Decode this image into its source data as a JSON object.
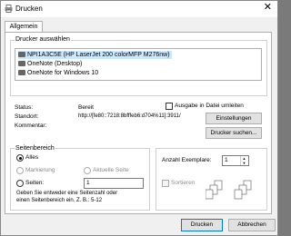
{
  "window": {
    "title": "Drucken"
  },
  "tabs": [
    {
      "label": "Allgemein"
    }
  ],
  "printers": {
    "group_label": "Drucker auswählen",
    "items": [
      {
        "label": "NPI1A3C5E (HP LaserJet 200 colorMFP M276nw)",
        "selected": true
      },
      {
        "label": "OneNote (Desktop)",
        "selected": false
      },
      {
        "label": "OneNote for Windows 10",
        "selected": false
      }
    ]
  },
  "details": {
    "status_label": "Status:",
    "status_value": "Bereit",
    "location_label": "Standort:",
    "location_value": "http://[fe80::7218:8bfffeb6:d704%11]:3911/",
    "comment_label": "Kommentar:",
    "print_to_file_label": "Ausgabe in Datei umleiten",
    "preferences_button": "Einstellungen",
    "find_printer_button": "Drucker suchen..."
  },
  "page_range": {
    "group_label": "Seitenbereich",
    "all_label": "Alles",
    "selection_label": "Markierung",
    "current_page_label": "Aktuelle Seite",
    "pages_label": "Seiten:",
    "pages_value": "1",
    "hint_line1": "Geben Sie entweder eine Seitenzahl oder",
    "hint_line2": "einen Seitenbereich ein. Z. B.: 5-12"
  },
  "copies": {
    "label": "Anzahl Exemplare:",
    "value": "1",
    "collate_label": "Sortieren"
  },
  "footer": {
    "print_button": "Drucken",
    "cancel_button": "Abbrechen"
  }
}
